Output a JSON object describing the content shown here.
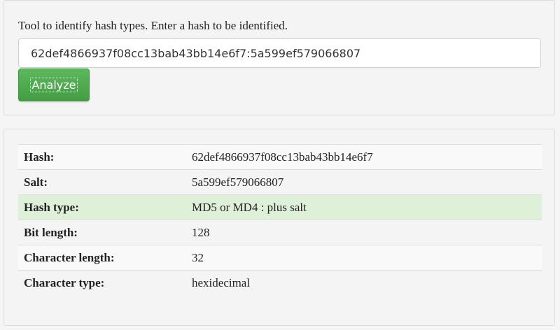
{
  "form": {
    "intro_text": "Tool to identify hash types. Enter a hash to be identified.",
    "hash_value": "62def4866937f08cc13bab43bb14e6f7:5a599ef579066807",
    "analyze_label": "Analyze",
    "accent_color": "#5cb85c"
  },
  "results": {
    "rows": [
      {
        "label": "Hash:",
        "value": "62def4866937f08cc13bab43bb14e6f7"
      },
      {
        "label": "Salt:",
        "value": "5a599ef579066807"
      },
      {
        "label": "Hash type:",
        "value": "MD5 or MD4 : plus salt",
        "highlight": true
      },
      {
        "label": "Bit length:",
        "value": "128"
      },
      {
        "label": "Character length:",
        "value": "32"
      },
      {
        "label": "Character type:",
        "value": "hexidecimal"
      }
    ],
    "highlight_color": "#dff0d8"
  }
}
